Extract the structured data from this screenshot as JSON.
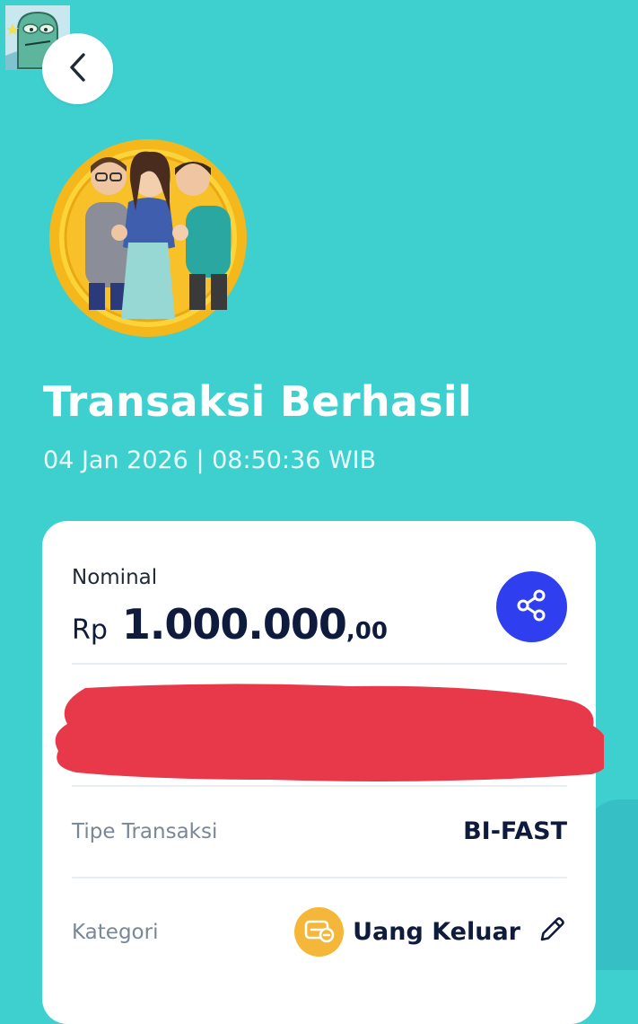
{
  "header": {
    "back_icon": "chevron-left-icon",
    "sticker_icon": "cartoon-avatar-sticker"
  },
  "status": {
    "title": "Transaksi Berhasil",
    "datetime": "04 Jan 2026 | 08:50:36 WIB",
    "illustration": "three-people-celebrating-coin"
  },
  "receipt": {
    "nominal_label": "Nominal",
    "currency": "Rp",
    "amount_integer": "1.000.000",
    "amount_decimal": ",00",
    "share_icon": "share-icon",
    "transaction_type_label": "Tipe Transaksi",
    "transaction_type_value": "BI-FAST",
    "category_label": "Kategori",
    "category_value": "Uang Keluar",
    "category_icon": "money-out-icon",
    "edit_icon": "pencil-icon"
  },
  "colors": {
    "background": "#3ecfcf",
    "card": "#ffffff",
    "share_button": "#2f3ff0",
    "redaction": "#e8394a",
    "category_icon_bg": "#f4b73a",
    "coin": "#f6c21c",
    "text_dark": "#0f1b3d",
    "text_muted": "#7a8795"
  }
}
